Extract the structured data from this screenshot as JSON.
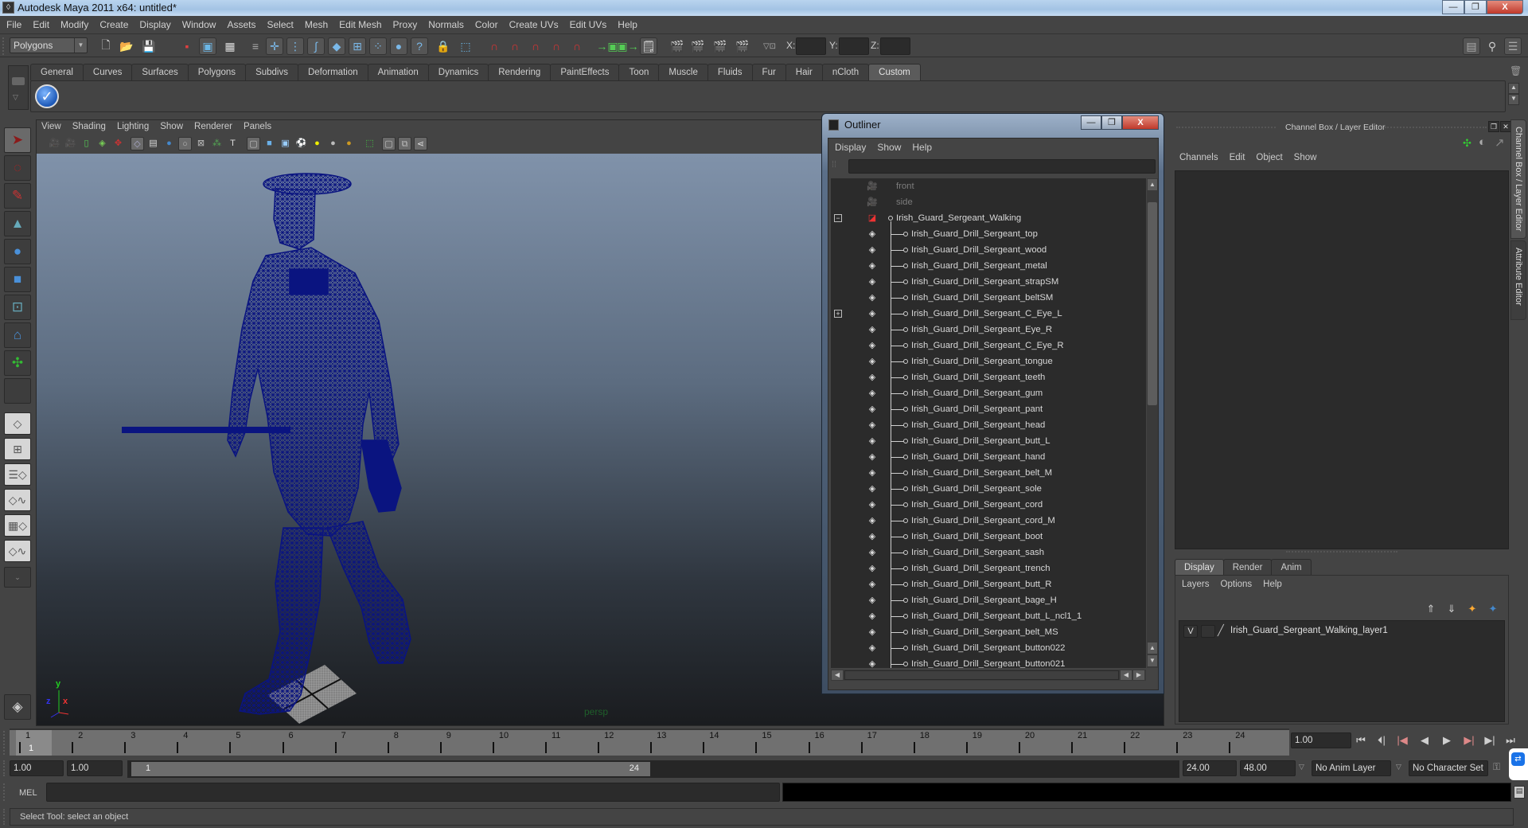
{
  "window": {
    "title": "Autodesk Maya 2011 x64: untitled*",
    "minimize_label": "—",
    "maximize_label": "❐",
    "close_label": "X"
  },
  "menubar": [
    "File",
    "Edit",
    "Modify",
    "Create",
    "Display",
    "Window",
    "Assets",
    "Select",
    "Mesh",
    "Edit Mesh",
    "Proxy",
    "Normals",
    "Color",
    "Create UVs",
    "Edit UVs",
    "Help"
  ],
  "statusline": {
    "mode": "Polygons",
    "coord_labels": [
      "X:",
      "Y:",
      "Z:"
    ],
    "coord_values": [
      "",
      "",
      ""
    ]
  },
  "shelf": {
    "tabs": [
      "General",
      "Curves",
      "Surfaces",
      "Polygons",
      "Subdivs",
      "Deformation",
      "Animation",
      "Dynamics",
      "Rendering",
      "PaintEffects",
      "Toon",
      "Muscle",
      "Fluids",
      "Fur",
      "Hair",
      "nCloth",
      "Custom"
    ],
    "active_tab": "Custom"
  },
  "viewport": {
    "menu": [
      "View",
      "Shading",
      "Lighting",
      "Show",
      "Renderer",
      "Panels"
    ],
    "camera_label": "persp",
    "axis": {
      "y": "y",
      "x": "x",
      "z": "z"
    }
  },
  "outliner": {
    "title": "Outliner",
    "menu": [
      "Display",
      "Show",
      "Help"
    ],
    "filter_value": "",
    "items": [
      {
        "label": "front",
        "type": "camera",
        "depth": 0
      },
      {
        "label": "side",
        "type": "camera",
        "depth": 0
      },
      {
        "label": "Irish_Guard_Sergeant_Walking",
        "type": "group",
        "depth": 0,
        "expanded": true
      },
      {
        "label": "Irish_Guard_Drill_Sergeant_top",
        "type": "mesh",
        "depth": 1
      },
      {
        "label": "Irish_Guard_Drill_Sergeant_wood",
        "type": "mesh",
        "depth": 1
      },
      {
        "label": "Irish_Guard_Drill_Sergeant_metal",
        "type": "mesh",
        "depth": 1
      },
      {
        "label": "Irish_Guard_Drill_Sergeant_strapSM",
        "type": "mesh",
        "depth": 1
      },
      {
        "label": "Irish_Guard_Drill_Sergeant_beltSM",
        "type": "mesh",
        "depth": 1
      },
      {
        "label": "Irish_Guard_Drill_Sergeant_C_Eye_L",
        "type": "mesh",
        "depth": 1,
        "collapsed": true
      },
      {
        "label": "Irish_Guard_Drill_Sergeant_Eye_R",
        "type": "mesh",
        "depth": 1
      },
      {
        "label": "Irish_Guard_Drill_Sergeant_C_Eye_R",
        "type": "mesh",
        "depth": 1
      },
      {
        "label": "Irish_Guard_Drill_Sergeant_tongue",
        "type": "mesh",
        "depth": 1
      },
      {
        "label": "Irish_Guard_Drill_Sergeant_teeth",
        "type": "mesh",
        "depth": 1
      },
      {
        "label": "Irish_Guard_Drill_Sergeant_gum",
        "type": "mesh",
        "depth": 1
      },
      {
        "label": "Irish_Guard_Drill_Sergeant_pant",
        "type": "mesh",
        "depth": 1
      },
      {
        "label": "Irish_Guard_Drill_Sergeant_head",
        "type": "mesh",
        "depth": 1
      },
      {
        "label": "Irish_Guard_Drill_Sergeant_butt_L",
        "type": "mesh",
        "depth": 1
      },
      {
        "label": "Irish_Guard_Drill_Sergeant_hand",
        "type": "mesh",
        "depth": 1
      },
      {
        "label": "Irish_Guard_Drill_Sergeant_belt_M",
        "type": "mesh",
        "depth": 1
      },
      {
        "label": "Irish_Guard_Drill_Sergeant_sole",
        "type": "mesh",
        "depth": 1
      },
      {
        "label": "Irish_Guard_Drill_Sergeant_cord",
        "type": "mesh",
        "depth": 1
      },
      {
        "label": "Irish_Guard_Drill_Sergeant_cord_M",
        "type": "mesh",
        "depth": 1
      },
      {
        "label": "Irish_Guard_Drill_Sergeant_boot",
        "type": "mesh",
        "depth": 1
      },
      {
        "label": "Irish_Guard_Drill_Sergeant_sash",
        "type": "mesh",
        "depth": 1
      },
      {
        "label": "Irish_Guard_Drill_Sergeant_trench",
        "type": "mesh",
        "depth": 1
      },
      {
        "label": "Irish_Guard_Drill_Sergeant_butt_R",
        "type": "mesh",
        "depth": 1
      },
      {
        "label": "Irish_Guard_Drill_Sergeant_bage_H",
        "type": "mesh",
        "depth": 1
      },
      {
        "label": "Irish_Guard_Drill_Sergeant_butt_L_ncl1_1",
        "type": "mesh",
        "depth": 1
      },
      {
        "label": "Irish_Guard_Drill_Sergeant_belt_MS",
        "type": "mesh",
        "depth": 1
      },
      {
        "label": "Irish_Guard_Drill_Sergeant_button022",
        "type": "mesh",
        "depth": 1
      },
      {
        "label": "Irish_Guard_Drill_Sergeant_button021",
        "type": "mesh",
        "depth": 1
      }
    ]
  },
  "channelbox": {
    "title": "Channel Box / Layer Editor",
    "menu": [
      "Channels",
      "Edit",
      "Object",
      "Show"
    ],
    "layer_tabs": [
      "Display",
      "Render",
      "Anim"
    ],
    "active_layer_tab": "Display",
    "layer_menu": [
      "Layers",
      "Options",
      "Help"
    ],
    "layers": [
      {
        "visible": "V",
        "name": "Irish_Guard_Sergeant_Walking_layer1"
      }
    ],
    "side_tabs": [
      "Channel Box / Layer Editor",
      "Attribute Editor"
    ]
  },
  "timeline": {
    "ticks": [
      "1",
      "2",
      "3",
      "4",
      "5",
      "6",
      "7",
      "8",
      "9",
      "10",
      "11",
      "12",
      "13",
      "14",
      "15",
      "16",
      "17",
      "18",
      "19",
      "20",
      "21",
      "22",
      "23",
      "24"
    ],
    "current_frame": "1",
    "current_time_field": "1.00"
  },
  "range": {
    "start_time": "1.00",
    "playback_start": "1.00",
    "slider_start": "1",
    "slider_end": "24",
    "playback_end": "24.00",
    "end_time": "48.00",
    "anim_layer": "No Anim Layer",
    "character_set": "No Character Set"
  },
  "playback_controls": [
    "go-to-start",
    "step-back-key",
    "step-back-frame",
    "play-backward",
    "play-forward",
    "step-forward-frame",
    "step-forward-key",
    "go-to-end"
  ],
  "mel": {
    "label": "MEL",
    "input": "",
    "output": ""
  },
  "helpline": "Select Tool: select an object"
}
